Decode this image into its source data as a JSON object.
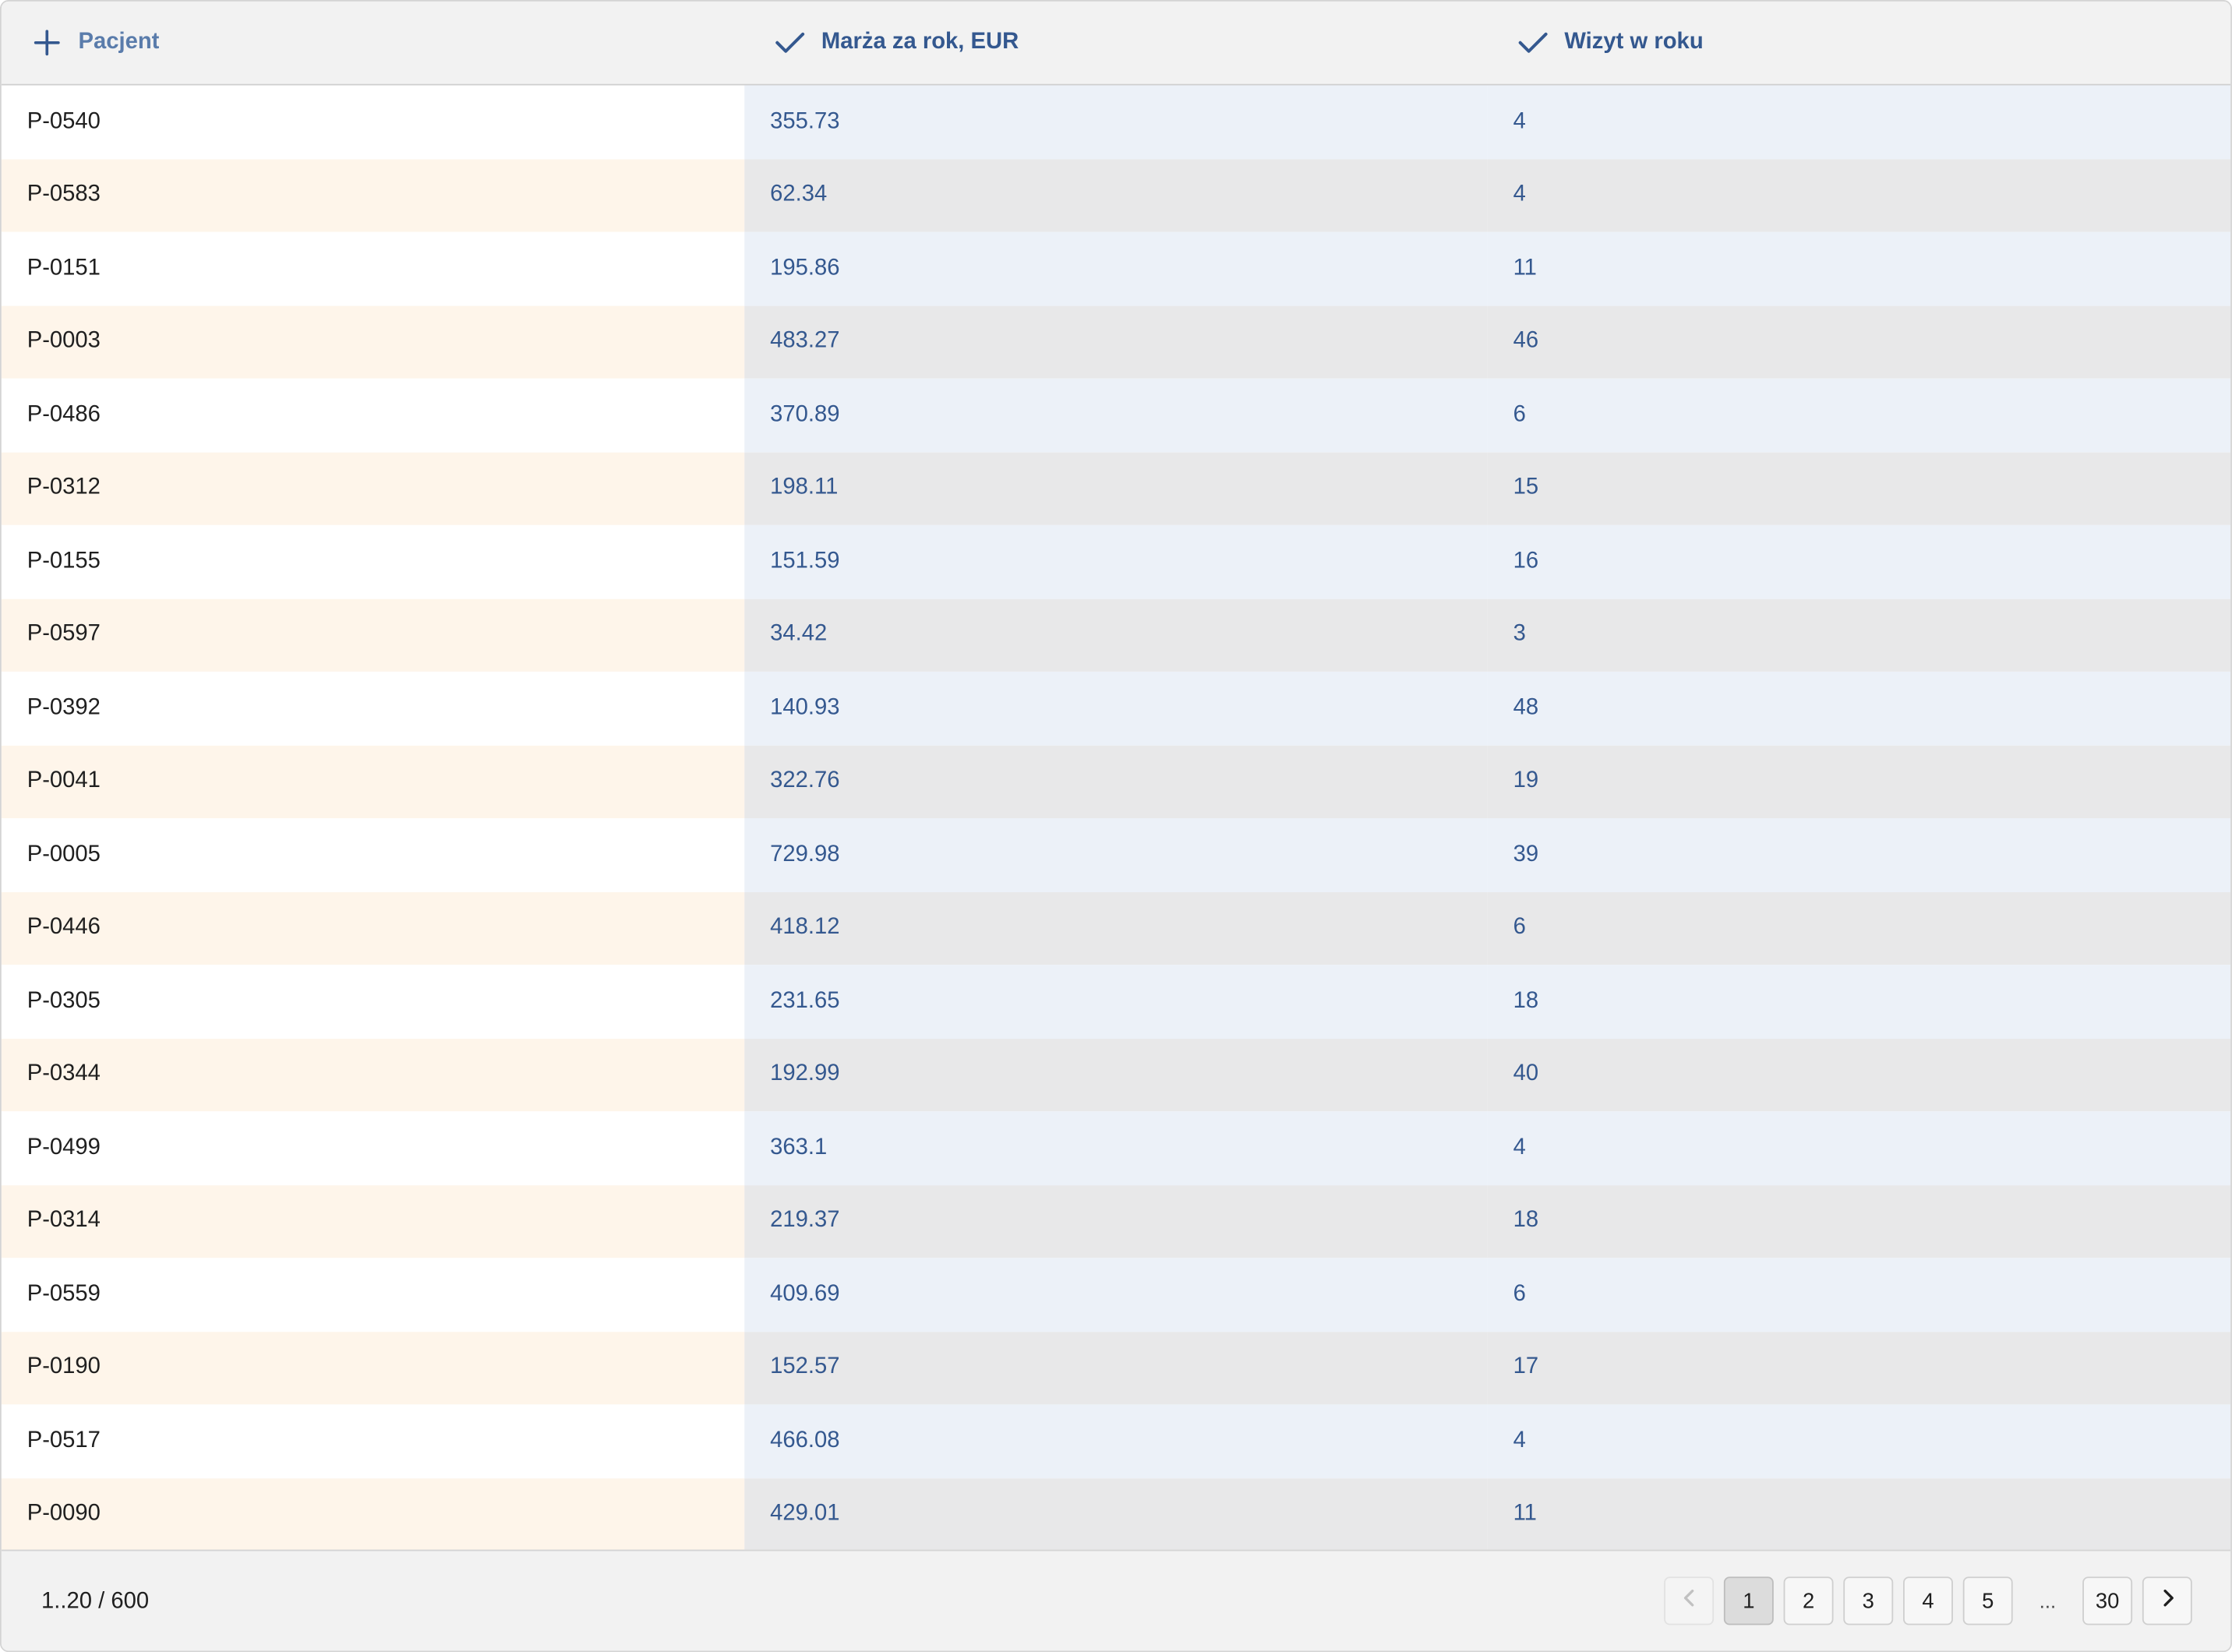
{
  "columns": [
    {
      "label": "Pacjent",
      "icon": "plus-icon"
    },
    {
      "label": "Marża za rok, EUR",
      "icon": "check-icon"
    },
    {
      "label": "Wizyt w roku",
      "icon": "check-icon"
    }
  ],
  "rows": [
    {
      "patient": "P-0540",
      "margin": "355.73",
      "visits": "4"
    },
    {
      "patient": "P-0583",
      "margin": "62.34",
      "visits": "4"
    },
    {
      "patient": "P-0151",
      "margin": "195.86",
      "visits": "11"
    },
    {
      "patient": "P-0003",
      "margin": "483.27",
      "visits": "46"
    },
    {
      "patient": "P-0486",
      "margin": "370.89",
      "visits": "6"
    },
    {
      "patient": "P-0312",
      "margin": "198.11",
      "visits": "15"
    },
    {
      "patient": "P-0155",
      "margin": "151.59",
      "visits": "16"
    },
    {
      "patient": "P-0597",
      "margin": "34.42",
      "visits": "3"
    },
    {
      "patient": "P-0392",
      "margin": "140.93",
      "visits": "48"
    },
    {
      "patient": "P-0041",
      "margin": "322.76",
      "visits": "19"
    },
    {
      "patient": "P-0005",
      "margin": "729.98",
      "visits": "39"
    },
    {
      "patient": "P-0446",
      "margin": "418.12",
      "visits": "6"
    },
    {
      "patient": "P-0305",
      "margin": "231.65",
      "visits": "18"
    },
    {
      "patient": "P-0344",
      "margin": "192.99",
      "visits": "40"
    },
    {
      "patient": "P-0499",
      "margin": "363.1",
      "visits": "4"
    },
    {
      "patient": "P-0314",
      "margin": "219.37",
      "visits": "18"
    },
    {
      "patient": "P-0559",
      "margin": "409.69",
      "visits": "6"
    },
    {
      "patient": "P-0190",
      "margin": "152.57",
      "visits": "17"
    },
    {
      "patient": "P-0517",
      "margin": "466.08",
      "visits": "4"
    },
    {
      "patient": "P-0090",
      "margin": "429.01",
      "visits": "11"
    }
  ],
  "footer": {
    "range_text": "1..20 / 600"
  },
  "pagination": {
    "prev_icon": "chevron-left-icon",
    "next_icon": "chevron-right-icon",
    "pages": [
      "1",
      "2",
      "3",
      "4",
      "5"
    ],
    "ellipsis": "...",
    "last_page": "30",
    "current_page": "1"
  },
  "colors": {
    "header_text": "#34588f",
    "header_bg": "#f2f2f2",
    "odd_first_col": "#ffffff",
    "even_first_col": "#fef5ea",
    "odd_data_col": "#ecf1f8",
    "even_data_col": "#e8e8e9"
  }
}
